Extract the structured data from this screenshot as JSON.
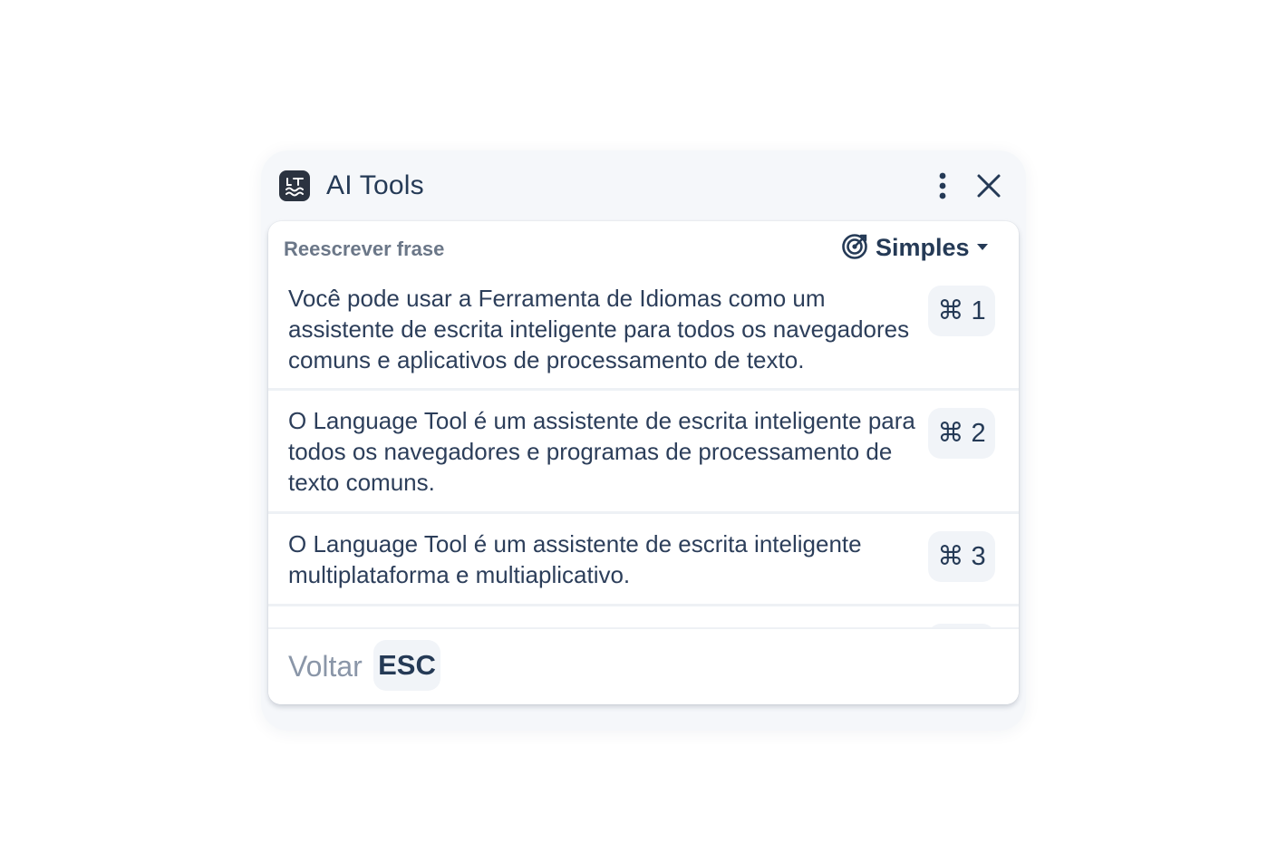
{
  "app": {
    "title": "AI Tools",
    "logo_icon": "languagetool-logo-icon"
  },
  "header": {
    "more_icon": "more-vertical-icon",
    "close_icon": "close-icon"
  },
  "section": {
    "label": "Reescrever frase",
    "mode": {
      "icon": "target-icon",
      "label": "Simples",
      "caret_icon": "caret-down-icon"
    }
  },
  "suggestions": [
    {
      "text": "Você pode usar a Ferramenta de Idiomas como um assistente de escrita inteligente para todos os navegadores comuns e aplicativos de processamento de texto.",
      "shortcut": "⌘ 1"
    },
    {
      "text": "O Language Tool é um assistente de escrita inteligente para todos os navegadores e programas de processamento de texto comuns.",
      "shortcut": "⌘ 2"
    },
    {
      "text": "O Language Tool é um assistente de escrita inteligente multiplataforma e multiaplicativo.",
      "shortcut": "⌘ 3"
    }
  ],
  "footer": {
    "back_label": "Voltar",
    "back_key": "ESC"
  },
  "colors": {
    "panel_bg": "#f5f7fa",
    "text_primary": "#253a56",
    "text_muted": "#6b7788",
    "key_bg": "#f1f4f8"
  }
}
